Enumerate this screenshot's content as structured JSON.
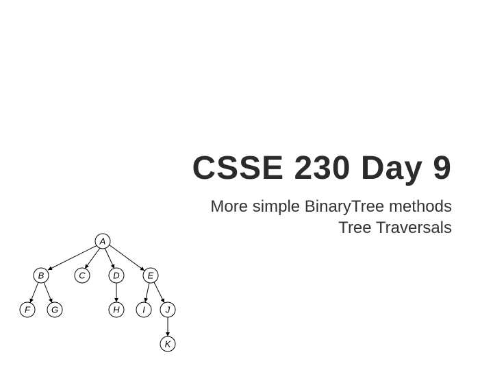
{
  "slide": {
    "title": "CSSE 230 Day 9",
    "subtitle_line1": "More simple BinaryTree methods",
    "subtitle_line2": "Tree Traversals"
  },
  "tree": {
    "nodes": {
      "A": "A",
      "B": "B",
      "C": "C",
      "D": "D",
      "E": "E",
      "F": "F",
      "G": "G",
      "H": "H",
      "I": "I",
      "J": "J",
      "K": "K"
    }
  }
}
